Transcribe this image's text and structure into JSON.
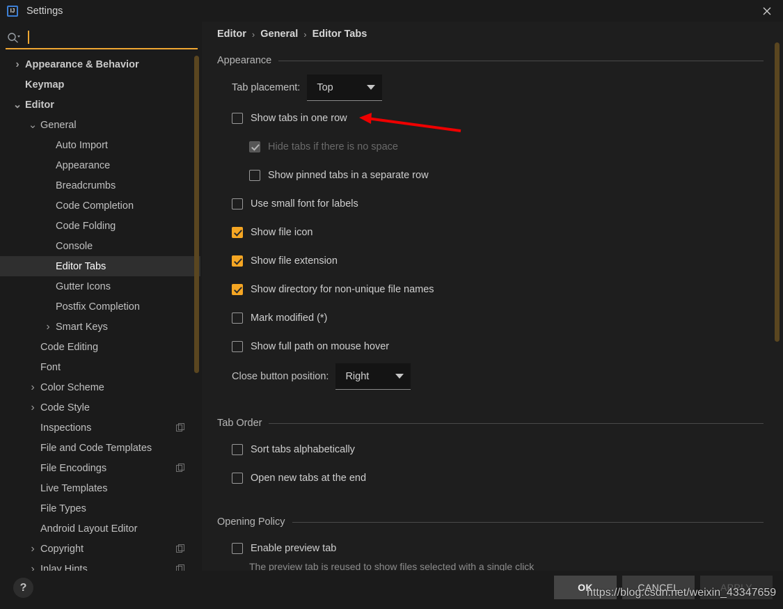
{
  "window": {
    "title": "Settings",
    "app_icon": "intellij-idea-icon",
    "close_icon": "close-icon"
  },
  "search": {
    "placeholder": "",
    "value": "",
    "icon": "search-icon"
  },
  "sidebar": {
    "items": [
      {
        "label": "Appearance & Behavior",
        "indent": 0,
        "arrow": "chevron-right",
        "bold": true,
        "selected": false,
        "copy_icon": false
      },
      {
        "label": "Keymap",
        "indent": 0,
        "arrow": "none",
        "bold": true,
        "selected": false,
        "copy_icon": false
      },
      {
        "label": "Editor",
        "indent": 0,
        "arrow": "chevron-down",
        "bold": true,
        "selected": false,
        "copy_icon": false
      },
      {
        "label": "General",
        "indent": 1,
        "arrow": "chevron-down",
        "bold": false,
        "selected": false,
        "copy_icon": false
      },
      {
        "label": "Auto Import",
        "indent": 2,
        "arrow": "none",
        "bold": false,
        "selected": false,
        "copy_icon": false
      },
      {
        "label": "Appearance",
        "indent": 2,
        "arrow": "none",
        "bold": false,
        "selected": false,
        "copy_icon": false
      },
      {
        "label": "Breadcrumbs",
        "indent": 2,
        "arrow": "none",
        "bold": false,
        "selected": false,
        "copy_icon": false
      },
      {
        "label": "Code Completion",
        "indent": 2,
        "arrow": "none",
        "bold": false,
        "selected": false,
        "copy_icon": false
      },
      {
        "label": "Code Folding",
        "indent": 2,
        "arrow": "none",
        "bold": false,
        "selected": false,
        "copy_icon": false
      },
      {
        "label": "Console",
        "indent": 2,
        "arrow": "none",
        "bold": false,
        "selected": false,
        "copy_icon": false
      },
      {
        "label": "Editor Tabs",
        "indent": 2,
        "arrow": "none",
        "bold": false,
        "selected": true,
        "copy_icon": false
      },
      {
        "label": "Gutter Icons",
        "indent": 2,
        "arrow": "none",
        "bold": false,
        "selected": false,
        "copy_icon": false
      },
      {
        "label": "Postfix Completion",
        "indent": 2,
        "arrow": "none",
        "bold": false,
        "selected": false,
        "copy_icon": false
      },
      {
        "label": "Smart Keys",
        "indent": 2,
        "arrow": "chevron-right",
        "bold": false,
        "selected": false,
        "copy_icon": false
      },
      {
        "label": "Code Editing",
        "indent": 1,
        "arrow": "none",
        "bold": false,
        "selected": false,
        "copy_icon": false
      },
      {
        "label": "Font",
        "indent": 1,
        "arrow": "none",
        "bold": false,
        "selected": false,
        "copy_icon": false
      },
      {
        "label": "Color Scheme",
        "indent": 1,
        "arrow": "chevron-right",
        "bold": false,
        "selected": false,
        "copy_icon": false
      },
      {
        "label": "Code Style",
        "indent": 1,
        "arrow": "chevron-right",
        "bold": false,
        "selected": false,
        "copy_icon": false
      },
      {
        "label": "Inspections",
        "indent": 1,
        "arrow": "none",
        "bold": false,
        "selected": false,
        "copy_icon": true
      },
      {
        "label": "File and Code Templates",
        "indent": 1,
        "arrow": "none",
        "bold": false,
        "selected": false,
        "copy_icon": false
      },
      {
        "label": "File Encodings",
        "indent": 1,
        "arrow": "none",
        "bold": false,
        "selected": false,
        "copy_icon": true
      },
      {
        "label": "Live Templates",
        "indent": 1,
        "arrow": "none",
        "bold": false,
        "selected": false,
        "copy_icon": false
      },
      {
        "label": "File Types",
        "indent": 1,
        "arrow": "none",
        "bold": false,
        "selected": false,
        "copy_icon": false
      },
      {
        "label": "Android Layout Editor",
        "indent": 1,
        "arrow": "none",
        "bold": false,
        "selected": false,
        "copy_icon": false
      },
      {
        "label": "Copyright",
        "indent": 1,
        "arrow": "chevron-right",
        "bold": false,
        "selected": false,
        "copy_icon": true
      },
      {
        "label": "Inlay Hints",
        "indent": 1,
        "arrow": "chevron-right",
        "bold": false,
        "selected": false,
        "copy_icon": true
      }
    ]
  },
  "breadcrumb": {
    "items": [
      "Editor",
      "General",
      "Editor Tabs"
    ],
    "separator": "›"
  },
  "sections": {
    "appearance": {
      "title": "Appearance",
      "tab_placement": {
        "label": "Tab placement:",
        "value": "Top"
      },
      "close_button_position": {
        "label": "Close button position:",
        "value": "Right"
      },
      "checkboxes": [
        {
          "label": "Show tabs in one row",
          "checked": false,
          "disabled": false,
          "indent": 0
        },
        {
          "label": "Hide tabs if there is no space",
          "checked": true,
          "disabled": true,
          "indent": 1
        },
        {
          "label": "Show pinned tabs in a separate row",
          "checked": false,
          "disabled": false,
          "indent": 1
        },
        {
          "label": "Use small font for labels",
          "checked": false,
          "disabled": false,
          "indent": 0
        },
        {
          "label": "Show file icon",
          "checked": true,
          "disabled": false,
          "indent": 0
        },
        {
          "label": "Show file extension",
          "checked": true,
          "disabled": false,
          "indent": 0
        },
        {
          "label": "Show directory for non-unique file names",
          "checked": true,
          "disabled": false,
          "indent": 0
        },
        {
          "label": "Mark modified (*)",
          "checked": false,
          "disabled": false,
          "indent": 0
        },
        {
          "label": "Show full path on mouse hover",
          "checked": false,
          "disabled": false,
          "indent": 0
        }
      ]
    },
    "tab_order": {
      "title": "Tab Order",
      "checkboxes": [
        {
          "label": "Sort tabs alphabetically",
          "checked": false,
          "disabled": false
        },
        {
          "label": "Open new tabs at the end",
          "checked": false,
          "disabled": false
        }
      ]
    },
    "opening_policy": {
      "title": "Opening Policy",
      "checkboxes": [
        {
          "label": "Enable preview tab",
          "checked": false,
          "disabled": false
        }
      ],
      "hint": "The preview tab is reused to show files selected with a single click"
    }
  },
  "footer": {
    "help_label": "?",
    "ok_label": "OK",
    "cancel_label": "CANCEL",
    "apply_label": "APPLY"
  },
  "watermark": "https://blog.csdn.net/weixin_43347659",
  "colors": {
    "accent_orange": "#f5a623",
    "search_underline": "#f0a732",
    "scrollbar": "#5a4620",
    "window_bg": "#1b1b1b",
    "panel_bg": "#1e1e1e",
    "selected_row": "#2f2f2f",
    "annotation_red": "#ee0000"
  }
}
